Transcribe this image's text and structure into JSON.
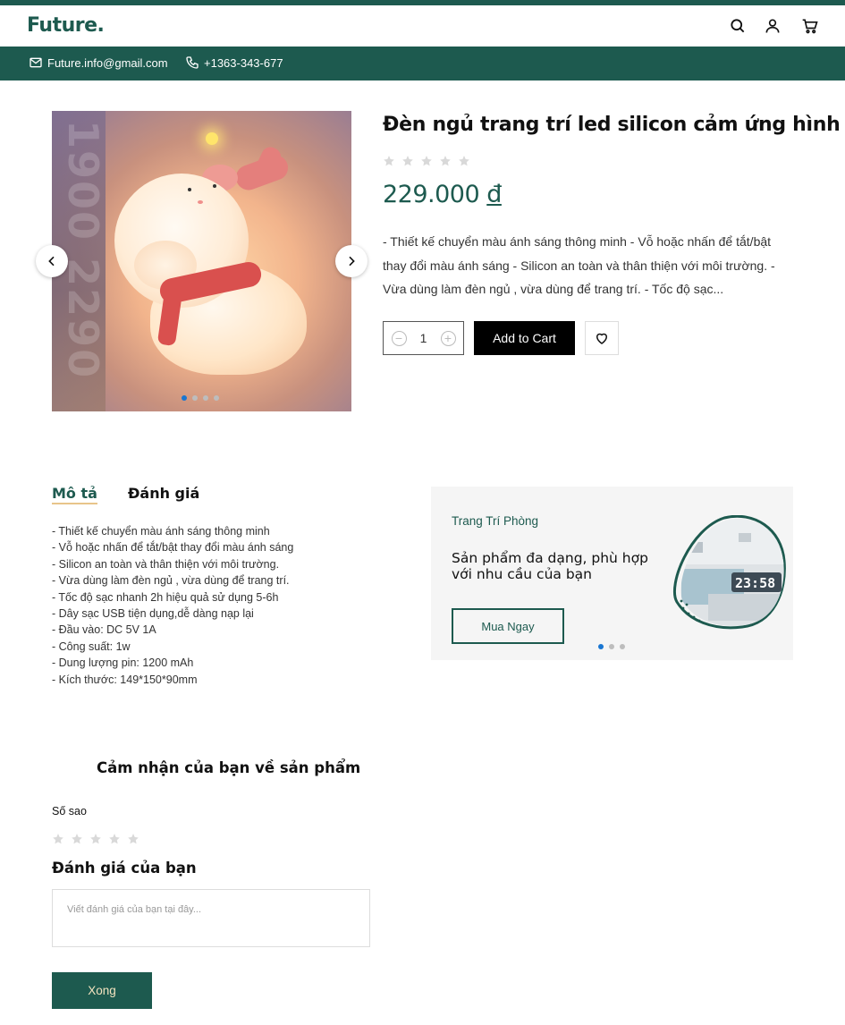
{
  "header": {
    "logo": "Future.",
    "icons": [
      "search-icon",
      "user-icon",
      "cart-icon"
    ]
  },
  "contact": {
    "email": "Future.info@gmail.com",
    "phone": "+1363-343-677"
  },
  "gallery": {
    "slide_count": 4,
    "active_index": 0,
    "watermark": "1900 2290"
  },
  "product": {
    "title": "Đèn ngủ trang trí led silicon cảm ứng hình",
    "rating": 0,
    "max_rating": 5,
    "price": "229.000",
    "currency": "đ",
    "short_description": "- Thiết kế chuyển màu ánh sáng thông minh - Vỗ hoặc nhấn để tắt/bật thay đổi màu ánh sáng - Silicon an toàn và thân thiện với môi trường. - Vừa dùng làm đèn ngủ , vừa dùng để trang trí. - Tốc độ sạc...",
    "quantity": "1",
    "add_to_cart_label": "Add to Cart"
  },
  "tabs": {
    "description": "Mô tả",
    "reviews": "Đánh giá",
    "active": "description"
  },
  "description_lines": [
    "- Thiết kế chuyển màu ánh sáng thông minh",
    "- Vỗ hoặc nhấn để tắt/bật thay đổi màu ánh sáng",
    "- Silicon an toàn và thân thiện với môi trường.",
    "- Vừa dùng làm đèn ngủ , vừa dùng để trang trí.",
    "- Tốc độ sạc nhanh 2h hiệu quả sử dụng 5-6h",
    "- Dây sạc USB tiện dụng,dễ dàng nạp lại",
    "- Đầu vào: DC 5V 1A",
    "- Công suất: 1w",
    "- Dung lượng pin: 1200 mAh",
    "- Kích thước: 149*150*90mm"
  ],
  "promo": {
    "category": "Trang Trí Phòng",
    "headline": "Sản phẩm đa dạng, phù hợp với nhu cầu của bạn",
    "button_label": "Mua Ngay",
    "clock_text": "23:58",
    "slide_count": 3,
    "active_index": 0
  },
  "review_form": {
    "title": "Cảm nhận của bạn về sản phẩm",
    "stars_label": "Số sao",
    "rating": 0,
    "max_rating": 5,
    "review_label": "Đánh giá của bạn",
    "review_placeholder": "Viết đánh giá của bạn tại đây...",
    "submit_label": "Xong"
  },
  "colors": {
    "brand": "#1d5a4f",
    "accent_underline": "#e8c58a",
    "active_dot": "#1976d2",
    "star_empty": "#d9d9d9"
  }
}
